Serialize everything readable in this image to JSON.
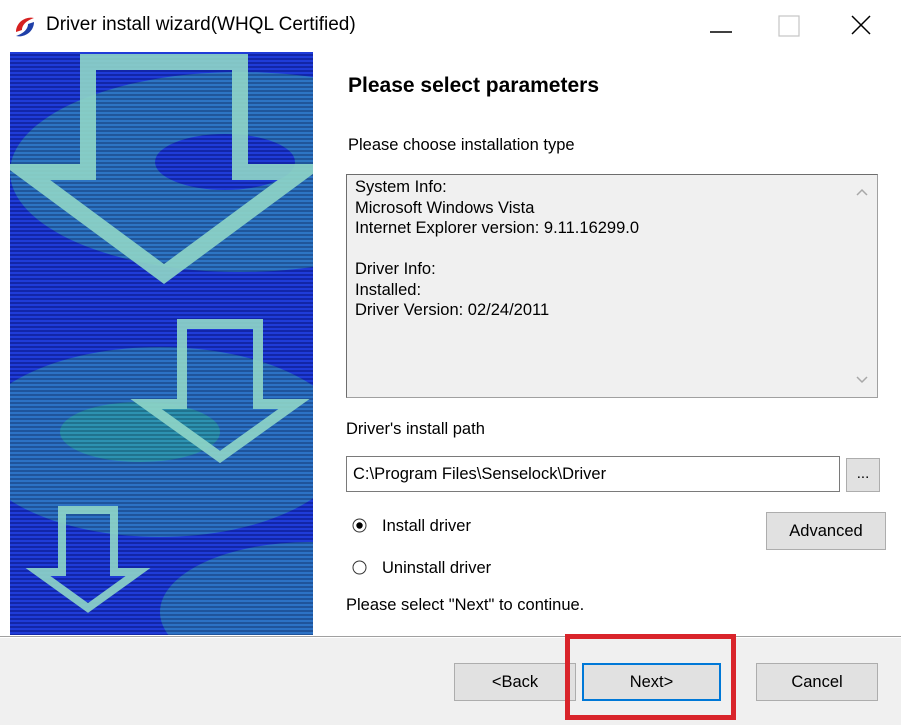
{
  "window": {
    "title": "Driver install wizard(WHQL Certified)",
    "icon": "senselock-app-icon"
  },
  "titlebar": {
    "minimize_icon": "minimize-icon",
    "maximize_icon": "maximize-icon",
    "close_icon": "close-icon"
  },
  "page": {
    "heading": "Please select parameters",
    "subtitle": "Please choose installation type"
  },
  "info": {
    "lines": [
      "System Info:",
      "Microsoft Windows Vista",
      "Internet Explorer version: 9.11.16299.0",
      "",
      "Driver Info:",
      "Installed:",
      "Driver Version: 02/24/2011"
    ]
  },
  "path": {
    "label": "Driver's install path",
    "value": "C:\\Program Files\\Senselock\\Driver",
    "browse_label": "..."
  },
  "options": {
    "install_label": "Install driver",
    "uninstall_label": "Uninstall driver",
    "selected": "install"
  },
  "advanced_label": "Advanced",
  "continue_text": "Please select \"Next\" to continue.",
  "buttons": {
    "back": "<Back",
    "next": "Next>",
    "cancel": "Cancel"
  },
  "colors": {
    "banner_blue": "#1a2fbe",
    "arrow_outline": "#7fd0c8",
    "highlight": "#d9242b",
    "focus": "#0078d7"
  }
}
